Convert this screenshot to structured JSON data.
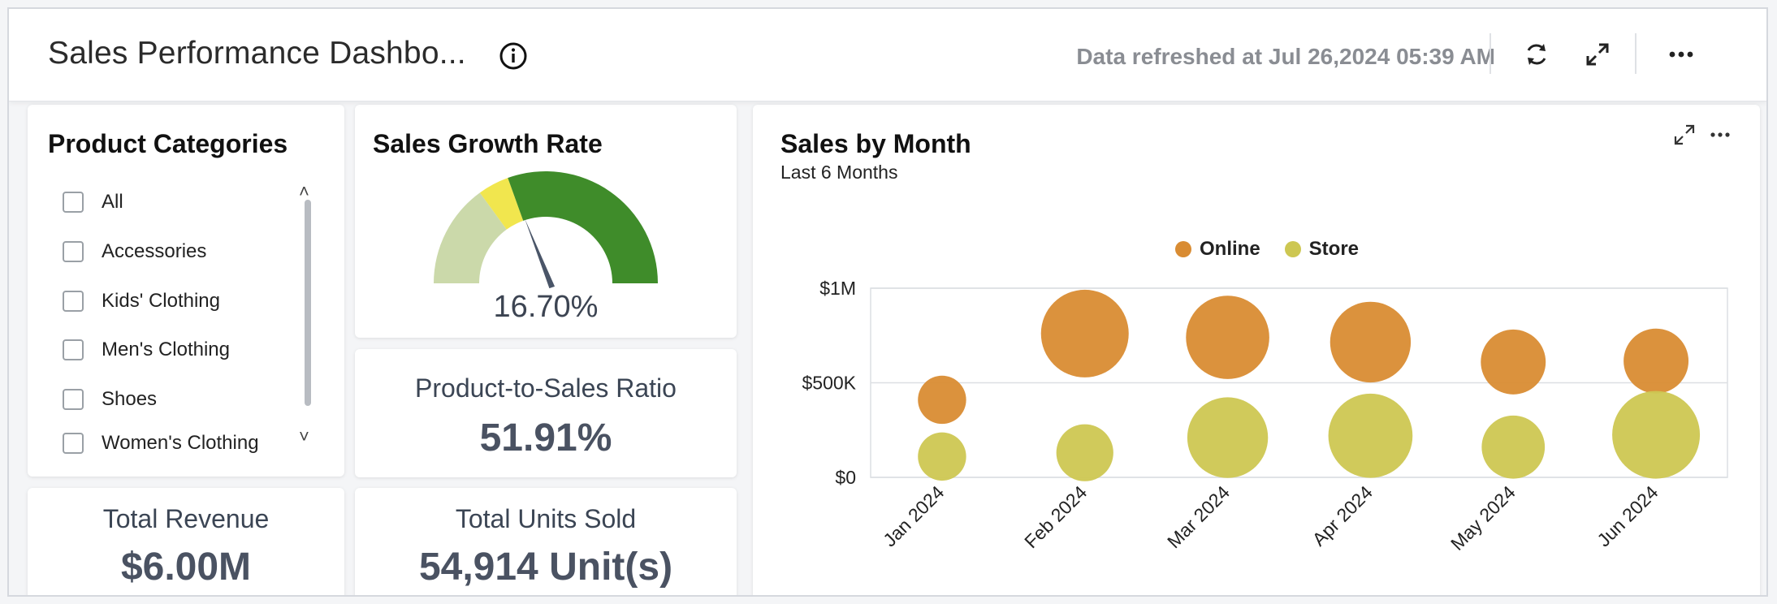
{
  "header": {
    "title": "Sales Performance Dashbo...",
    "refreshed": "Data refreshed at Jul 26,2024 05:39 AM",
    "icons": [
      "info-icon",
      "refresh-icon",
      "fullscreen-icon",
      "more-icon"
    ]
  },
  "filters": {
    "title": "Product Categories",
    "items": [
      {
        "label": "All",
        "checked": false
      },
      {
        "label": "Accessories",
        "checked": false
      },
      {
        "label": "Kids' Clothing",
        "checked": false
      },
      {
        "label": "Men's Clothing",
        "checked": false
      },
      {
        "label": "Shoes",
        "checked": false
      },
      {
        "label": "Women's Clothing",
        "checked": false
      }
    ],
    "scroll_up": "˄",
    "scroll_down": "˅"
  },
  "growth": {
    "title": "Sales Growth Rate",
    "value": "16.70%",
    "gauge": {
      "value": 16.7,
      "bands": [
        {
          "to": 0.3,
          "color": "#cbd9aa"
        },
        {
          "to": 0.39,
          "color": "#f1e64e"
        },
        {
          "to": 1.0,
          "color": "#3f8c2a"
        }
      ],
      "needle_fraction": 0.4,
      "needle_color": "#4a5568"
    }
  },
  "ratio": {
    "label": "Product-to-Sales Ratio",
    "value": "51.91%"
  },
  "revenue": {
    "label": "Total Revenue",
    "value": "$6.00M"
  },
  "units": {
    "label": "Total Units Sold",
    "value": "54,914 Unit(s)"
  },
  "chart": {
    "title": "Sales by Month",
    "subtitle": "Last 6 Months",
    "legend": [
      {
        "name": "Online",
        "color": "#d98c33"
      },
      {
        "name": "Store",
        "color": "#cdc752"
      }
    ]
  },
  "chart_data": {
    "type": "scatter",
    "title": "Sales by Month",
    "subtitle": "Last 6 Months",
    "categories": [
      "Jan 2024",
      "Feb 2024",
      "Mar 2024",
      "Apr 2024",
      "May 2024",
      "Jun 2024"
    ],
    "ylim": [
      0,
      1000000
    ],
    "yticks": [
      {
        "value": 0,
        "label": "$0"
      },
      {
        "value": 500000,
        "label": "$500K"
      },
      {
        "value": 1000000,
        "label": "$1M"
      }
    ],
    "grid": true,
    "legend_position": "top",
    "series": [
      {
        "name": "Online",
        "color": "#d98c33",
        "values": [
          410000,
          760000,
          740000,
          715000,
          610000,
          615000
        ],
        "bubble_size": [
          0.55,
          1.0,
          0.95,
          0.92,
          0.74,
          0.74
        ]
      },
      {
        "name": "Store",
        "color": "#cdc752",
        "values": [
          110000,
          130000,
          210000,
          220000,
          160000,
          225000
        ],
        "bubble_size": [
          0.55,
          0.65,
          0.92,
          0.96,
          0.72,
          1.0
        ]
      }
    ]
  }
}
